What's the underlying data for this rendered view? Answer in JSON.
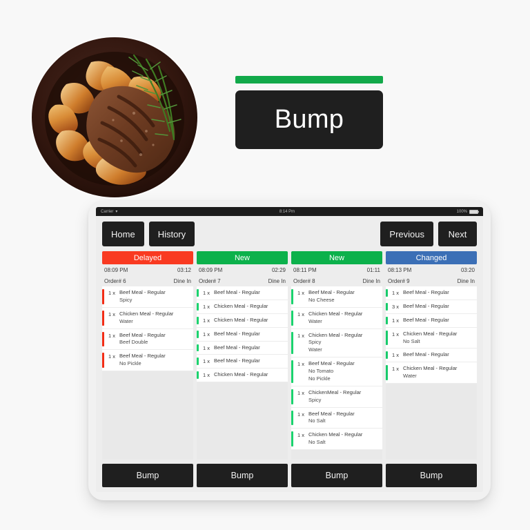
{
  "callout": {
    "bar_color": "#12a94a",
    "label": "Bump"
  },
  "photo": {
    "alt": "steak-with-potato-wedges-and-rosemary-in-dark-bowl"
  },
  "device": {
    "status_bar": {
      "carrier": "Carrier",
      "wifi_icon": "wifi-icon",
      "time": "8:14 Pm",
      "battery_percent": "100%",
      "battery_icon": "battery-full-icon"
    }
  },
  "topnav": {
    "home_label": "Home",
    "history_label": "History",
    "previous_label": "Previous",
    "next_label": "Next"
  },
  "bump_row": {
    "label": "Bump"
  },
  "status_colors": {
    "Delayed": "#f93a21",
    "New": "#0cb14b",
    "Changed": "#3b6fb6"
  },
  "accent_colors": {
    "Delayed": "#f22d16",
    "New": "#1bd36e",
    "Changed": "#17cb6b"
  },
  "orders": [
    {
      "status": "Delayed",
      "time": "08:09 PM",
      "elapsed": "03:12",
      "order_no": "Order# 6",
      "order_type": "Dine In",
      "items": [
        {
          "qty": "1 x",
          "name": "Beef Meal - Regular",
          "mods": [
            "Spicy"
          ]
        },
        {
          "qty": "1 x",
          "name": "Chicken Meal - Regular",
          "mods": [
            "Water"
          ]
        },
        {
          "qty": "1 x",
          "name": "Beef Meal - Regular",
          "mods": [
            "Beef Double"
          ]
        },
        {
          "qty": "1 x",
          "name": "Beef Meal - Regular",
          "mods": [
            "No Pickle"
          ]
        }
      ]
    },
    {
      "status": "New",
      "time": "08:09 PM",
      "elapsed": "02:29",
      "order_no": "Order# 7",
      "order_type": "Dine In",
      "items": [
        {
          "qty": "1 x",
          "name": "Beef Meal - Regular",
          "mods": []
        },
        {
          "qty": "1 x",
          "name": "Chicken Meal - Regular",
          "mods": []
        },
        {
          "qty": "1 x",
          "name": "Chicken Meal - Regular",
          "mods": []
        },
        {
          "qty": "1 x",
          "name": "Beef Meal - Regular",
          "mods": []
        },
        {
          "qty": "1 x",
          "name": "Beef Meal - Regular",
          "mods": []
        },
        {
          "qty": "1 x",
          "name": "Beef Meal - Regular",
          "mods": []
        },
        {
          "qty": "1 x",
          "name": "Chicken Meal - Regular",
          "mods": []
        }
      ]
    },
    {
      "status": "New",
      "time": "08:11 PM",
      "elapsed": "01:11",
      "order_no": "Order# 8",
      "order_type": "Dine In",
      "items": [
        {
          "qty": "1 x",
          "name": "Beef Meal - Regular",
          "mods": [
            "No Cheese"
          ]
        },
        {
          "qty": "1 x",
          "name": "Chicken Meal - Regular",
          "mods": [
            "Water"
          ]
        },
        {
          "qty": "1 x",
          "name": "Chicken Meal - Regular",
          "mods": [
            "Spicy",
            "Water"
          ]
        },
        {
          "qty": "1 x",
          "name": "Beef Meal - Regular",
          "mods": [
            "No Tomato",
            "No Pickle"
          ]
        },
        {
          "qty": "1 x",
          "name": "ChickenMeal - Regular",
          "mods": [
            "Spicy"
          ]
        },
        {
          "qty": "1 x",
          "name": "Beef Meal - Regular",
          "mods": [
            "No Salt"
          ]
        },
        {
          "qty": "1 x",
          "name": "Chicken Meal - Regular",
          "mods": [
            "No Salt"
          ]
        }
      ]
    },
    {
      "status": "Changed",
      "time": "08:13 PM",
      "elapsed": "03:20",
      "order_no": "Order# 9",
      "order_type": "Dine In",
      "items": [
        {
          "qty": "1 x",
          "name": "Beef Meal - Regular",
          "mods": []
        },
        {
          "qty": "3 x",
          "name": "Beef Meal - Regular",
          "mods": []
        },
        {
          "qty": "1 x",
          "name": "Beef Meal - Regular",
          "mods": []
        },
        {
          "qty": "1 x",
          "name": "Chicken Meal - Regular",
          "mods": [
            "No Salt"
          ]
        },
        {
          "qty": "1 x",
          "name": "Beef Meal - Regular",
          "mods": []
        },
        {
          "qty": "1 x",
          "name": "Chicken Meal - Regular",
          "mods": [
            "Water"
          ]
        }
      ]
    }
  ]
}
